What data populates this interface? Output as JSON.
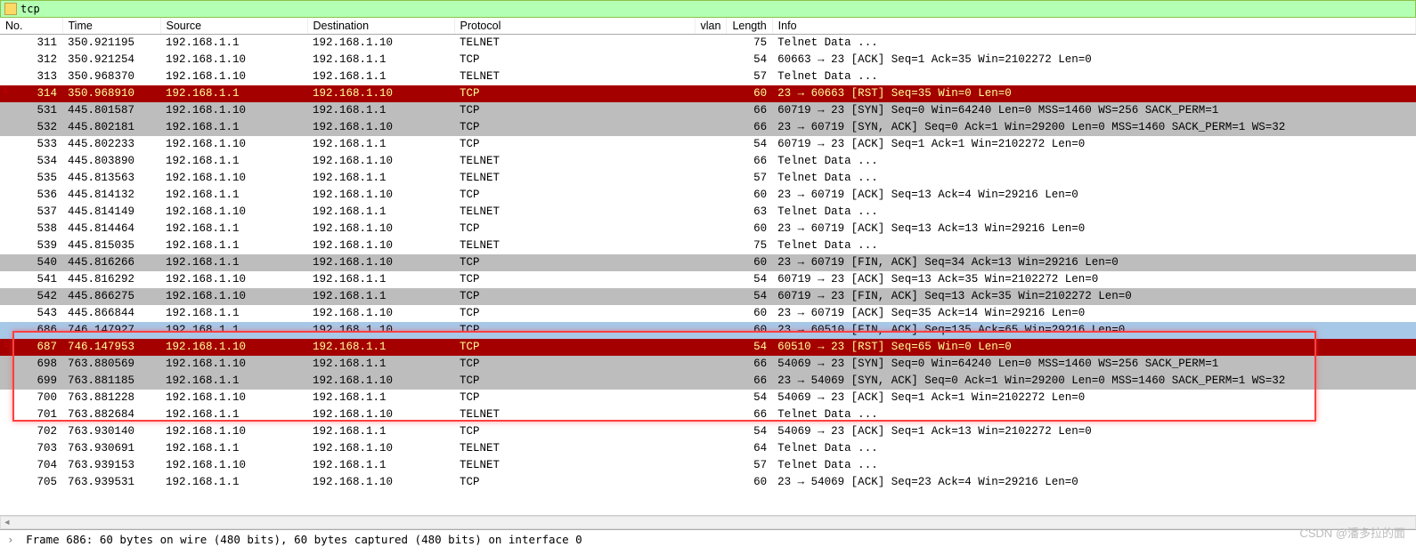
{
  "filter": {
    "text": "tcp"
  },
  "columns": {
    "no": "No.",
    "time": "Time",
    "source": "Source",
    "destination": "Destination",
    "protocol": "Protocol",
    "vlan": "vlan",
    "length": "Length",
    "info": "Info"
  },
  "packets": [
    {
      "no": "311",
      "time": "350.921195",
      "src": "192.168.1.1",
      "dst": "192.168.1.10",
      "proto": "TELNET",
      "len": "75",
      "info": "Telnet Data ...",
      "cls": "white"
    },
    {
      "no": "312",
      "time": "350.921254",
      "src": "192.168.1.10",
      "dst": "192.168.1.1",
      "proto": "TCP",
      "len": "54",
      "info": "60663 → 23 [ACK] Seq=1 Ack=35 Win=2102272 Len=0",
      "cls": "white"
    },
    {
      "no": "313",
      "time": "350.968370",
      "src": "192.168.1.10",
      "dst": "192.168.1.1",
      "proto": "TELNET",
      "len": "57",
      "info": "Telnet Data ...",
      "cls": "white"
    },
    {
      "no": "314",
      "time": "350.968910",
      "src": "192.168.1.1",
      "dst": "192.168.1.10",
      "proto": "TCP",
      "len": "60",
      "info": "23 → 60663 [RST] Seq=35 Win=0 Len=0",
      "cls": "red",
      "marker": "└"
    },
    {
      "no": "531",
      "time": "445.801587",
      "src": "192.168.1.10",
      "dst": "192.168.1.1",
      "proto": "TCP",
      "len": "66",
      "info": "60719 → 23 [SYN] Seq=0 Win=64240 Len=0 MSS=1460 WS=256 SACK_PERM=1",
      "cls": "gray"
    },
    {
      "no": "532",
      "time": "445.802181",
      "src": "192.168.1.1",
      "dst": "192.168.1.10",
      "proto": "TCP",
      "len": "66",
      "info": "23 → 60719 [SYN, ACK] Seq=0 Ack=1 Win=29200 Len=0 MSS=1460 SACK_PERM=1 WS=32",
      "cls": "gray"
    },
    {
      "no": "533",
      "time": "445.802233",
      "src": "192.168.1.10",
      "dst": "192.168.1.1",
      "proto": "TCP",
      "len": "54",
      "info": "60719 → 23 [ACK] Seq=1 Ack=1 Win=2102272 Len=0",
      "cls": "white"
    },
    {
      "no": "534",
      "time": "445.803890",
      "src": "192.168.1.1",
      "dst": "192.168.1.10",
      "proto": "TELNET",
      "len": "66",
      "info": "Telnet Data ...",
      "cls": "white"
    },
    {
      "no": "535",
      "time": "445.813563",
      "src": "192.168.1.10",
      "dst": "192.168.1.1",
      "proto": "TELNET",
      "len": "57",
      "info": "Telnet Data ...",
      "cls": "white"
    },
    {
      "no": "536",
      "time": "445.814132",
      "src": "192.168.1.1",
      "dst": "192.168.1.10",
      "proto": "TCP",
      "len": "60",
      "info": "23 → 60719 [ACK] Seq=13 Ack=4 Win=29216 Len=0",
      "cls": "white"
    },
    {
      "no": "537",
      "time": "445.814149",
      "src": "192.168.1.10",
      "dst": "192.168.1.1",
      "proto": "TELNET",
      "len": "63",
      "info": "Telnet Data ...",
      "cls": "white"
    },
    {
      "no": "538",
      "time": "445.814464",
      "src": "192.168.1.1",
      "dst": "192.168.1.10",
      "proto": "TCP",
      "len": "60",
      "info": "23 → 60719 [ACK] Seq=13 Ack=13 Win=29216 Len=0",
      "cls": "white"
    },
    {
      "no": "539",
      "time": "445.815035",
      "src": "192.168.1.1",
      "dst": "192.168.1.10",
      "proto": "TELNET",
      "len": "75",
      "info": "Telnet Data ...",
      "cls": "white"
    },
    {
      "no": "540",
      "time": "445.816266",
      "src": "192.168.1.1",
      "dst": "192.168.1.10",
      "proto": "TCP",
      "len": "60",
      "info": "23 → 60719 [FIN, ACK] Seq=34 Ack=13 Win=29216 Len=0",
      "cls": "gray"
    },
    {
      "no": "541",
      "time": "445.816292",
      "src": "192.168.1.10",
      "dst": "192.168.1.1",
      "proto": "TCP",
      "len": "54",
      "info": "60719 → 23 [ACK] Seq=13 Ack=35 Win=2102272 Len=0",
      "cls": "white"
    },
    {
      "no": "542",
      "time": "445.866275",
      "src": "192.168.1.10",
      "dst": "192.168.1.1",
      "proto": "TCP",
      "len": "54",
      "info": "60719 → 23 [FIN, ACK] Seq=13 Ack=35 Win=2102272 Len=0",
      "cls": "gray"
    },
    {
      "no": "543",
      "time": "445.866844",
      "src": "192.168.1.1",
      "dst": "192.168.1.10",
      "proto": "TCP",
      "len": "60",
      "info": "23 → 60719 [ACK] Seq=35 Ack=14 Win=29216 Len=0",
      "cls": "white"
    },
    {
      "no": "686",
      "time": "746.147927",
      "src": "192.168.1.1",
      "dst": "192.168.1.10",
      "proto": "TCP",
      "len": "60",
      "info": "23 → 60510 [FIN, ACK] Seq=135 Ack=65 Win=29216 Len=0",
      "cls": "selected"
    },
    {
      "no": "687",
      "time": "746.147953",
      "src": "192.168.1.10",
      "dst": "192.168.1.1",
      "proto": "TCP",
      "len": "54",
      "info": "60510 → 23 [RST] Seq=65 Win=0 Len=0",
      "cls": "red",
      "marker": "└"
    },
    {
      "no": "698",
      "time": "763.880569",
      "src": "192.168.1.10",
      "dst": "192.168.1.1",
      "proto": "TCP",
      "len": "66",
      "info": "54069 → 23 [SYN] Seq=0 Win=64240 Len=0 MSS=1460 WS=256 SACK_PERM=1",
      "cls": "gray"
    },
    {
      "no": "699",
      "time": "763.881185",
      "src": "192.168.1.1",
      "dst": "192.168.1.10",
      "proto": "TCP",
      "len": "66",
      "info": "23 → 54069 [SYN, ACK] Seq=0 Ack=1 Win=29200 Len=0 MSS=1460 SACK_PERM=1 WS=32",
      "cls": "gray"
    },
    {
      "no": "700",
      "time": "763.881228",
      "src": "192.168.1.10",
      "dst": "192.168.1.1",
      "proto": "TCP",
      "len": "54",
      "info": "54069 → 23 [ACK] Seq=1 Ack=1 Win=2102272 Len=0",
      "cls": "white"
    },
    {
      "no": "701",
      "time": "763.882684",
      "src": "192.168.1.1",
      "dst": "192.168.1.10",
      "proto": "TELNET",
      "len": "66",
      "info": "Telnet Data ...",
      "cls": "white"
    },
    {
      "no": "702",
      "time": "763.930140",
      "src": "192.168.1.10",
      "dst": "192.168.1.1",
      "proto": "TCP",
      "len": "54",
      "info": "54069 → 23 [ACK] Seq=1 Ack=13 Win=2102272 Len=0",
      "cls": "white"
    },
    {
      "no": "703",
      "time": "763.930691",
      "src": "192.168.1.1",
      "dst": "192.168.1.10",
      "proto": "TELNET",
      "len": "64",
      "info": "Telnet Data ...",
      "cls": "white"
    },
    {
      "no": "704",
      "time": "763.939153",
      "src": "192.168.1.10",
      "dst": "192.168.1.1",
      "proto": "TELNET",
      "len": "57",
      "info": "Telnet Data ...",
      "cls": "white"
    },
    {
      "no": "705",
      "time": "763.939531",
      "src": "192.168.1.1",
      "dst": "192.168.1.10",
      "proto": "TCP",
      "len": "60",
      "info": "23 → 54069 [ACK] Seq=23 Ack=4 Win=29216 Len=0",
      "cls": "white"
    }
  ],
  "detail": {
    "frame_summary": "Frame 686: 60 bytes on wire (480 bits), 60 bytes captured (480 bits) on interface 0"
  },
  "watermark": "CSDN @潘多拉的面"
}
